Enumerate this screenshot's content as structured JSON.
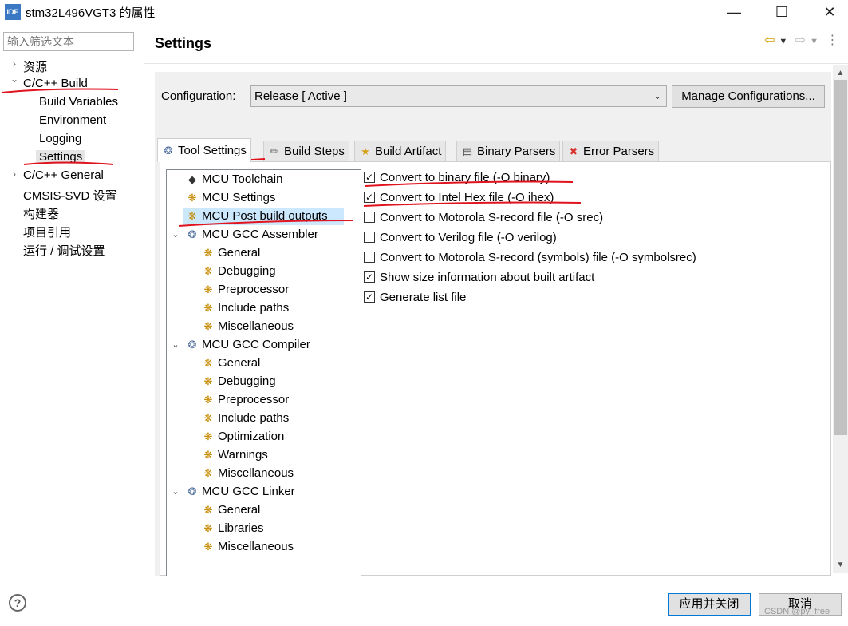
{
  "window": {
    "app_icon": "IDE",
    "title": "stm32L496VGT3 的属性",
    "minimize_icon": "minimize-icon",
    "maximize_icon": "maximize-icon",
    "close_icon": "close-icon"
  },
  "sidebar": {
    "filter_placeholder": "输入筛选文本",
    "items": [
      {
        "label": "资源",
        "chevron": "›"
      },
      {
        "label": "C/C++ Build",
        "chevron": "⌄"
      },
      {
        "label": "Build Variables"
      },
      {
        "label": "Environment"
      },
      {
        "label": "Logging"
      },
      {
        "label": "Settings"
      },
      {
        "label": "C/C++ General",
        "chevron": "›"
      },
      {
        "label": "CMSIS-SVD 设置"
      },
      {
        "label": "构建器"
      },
      {
        "label": "项目引用"
      },
      {
        "label": "运行 / 调试设置"
      }
    ]
  },
  "header": {
    "title": "Settings",
    "back_icon": "back-arrow-icon",
    "forward_icon": "forward-arrow-icon",
    "menu_icon": "more-icon"
  },
  "configuration": {
    "label": "Configuration:",
    "selected": "Release  [ Active ]",
    "manage_button": "Manage Configurations..."
  },
  "tabs": [
    {
      "label": "Tool Settings",
      "icon": "tool-settings-icon",
      "active": true
    },
    {
      "label": "Build Steps",
      "icon": "build-steps-icon"
    },
    {
      "label": "Build Artifact",
      "icon": "build-artifact-icon"
    },
    {
      "label": "Binary Parsers",
      "icon": "binary-parsers-icon"
    },
    {
      "label": "Error Parsers",
      "icon": "error-parsers-icon"
    }
  ],
  "tree": [
    {
      "label": "MCU Toolchain",
      "icon": "chip-icon"
    },
    {
      "label": "MCU Settings",
      "icon": "settings-icon"
    },
    {
      "label": "MCU Post build outputs",
      "icon": "settings-icon",
      "selected": true
    },
    {
      "label": "MCU GCC Assembler",
      "icon": "tool-icon",
      "expanded": true
    },
    {
      "label": "General",
      "icon": "settings-icon"
    },
    {
      "label": "Debugging",
      "icon": "settings-icon"
    },
    {
      "label": "Preprocessor",
      "icon": "settings-icon"
    },
    {
      "label": "Include paths",
      "icon": "settings-icon"
    },
    {
      "label": "Miscellaneous",
      "icon": "settings-icon"
    },
    {
      "label": "MCU GCC Compiler",
      "icon": "tool-icon",
      "expanded": true
    },
    {
      "label": "General",
      "icon": "settings-icon"
    },
    {
      "label": "Debugging",
      "icon": "settings-icon"
    },
    {
      "label": "Preprocessor",
      "icon": "settings-icon"
    },
    {
      "label": "Include paths",
      "icon": "settings-icon"
    },
    {
      "label": "Optimization",
      "icon": "settings-icon"
    },
    {
      "label": "Warnings",
      "icon": "settings-icon"
    },
    {
      "label": "Miscellaneous",
      "icon": "settings-icon"
    },
    {
      "label": "MCU GCC Linker",
      "icon": "tool-icon",
      "expanded": true
    },
    {
      "label": "General",
      "icon": "settings-icon"
    },
    {
      "label": "Libraries",
      "icon": "settings-icon"
    },
    {
      "label": "Miscellaneous",
      "icon": "settings-icon"
    }
  ],
  "options": [
    {
      "label": "Convert to binary file (-O binary)",
      "checked": true
    },
    {
      "label": "Convert to Intel Hex file (-O ihex)",
      "checked": true
    },
    {
      "label": "Convert to Motorola S-record file (-O srec)",
      "checked": false
    },
    {
      "label": "Convert to Verilog file (-O verilog)",
      "checked": false
    },
    {
      "label": "Convert to Motorola S-record (symbols) file (-O symbolsrec)",
      "checked": false
    },
    {
      "label": "Show size information about built artifact",
      "checked": true
    },
    {
      "label": "Generate list file",
      "checked": true
    }
  ],
  "footer": {
    "help_icon": "help-icon",
    "apply_close": "应用并关闭",
    "cancel": "取消",
    "watermark": "CSDN @py_free"
  },
  "colors": {
    "annotation": "#e0141e",
    "selection": "#cce8ff",
    "accent": "#0078d7"
  }
}
